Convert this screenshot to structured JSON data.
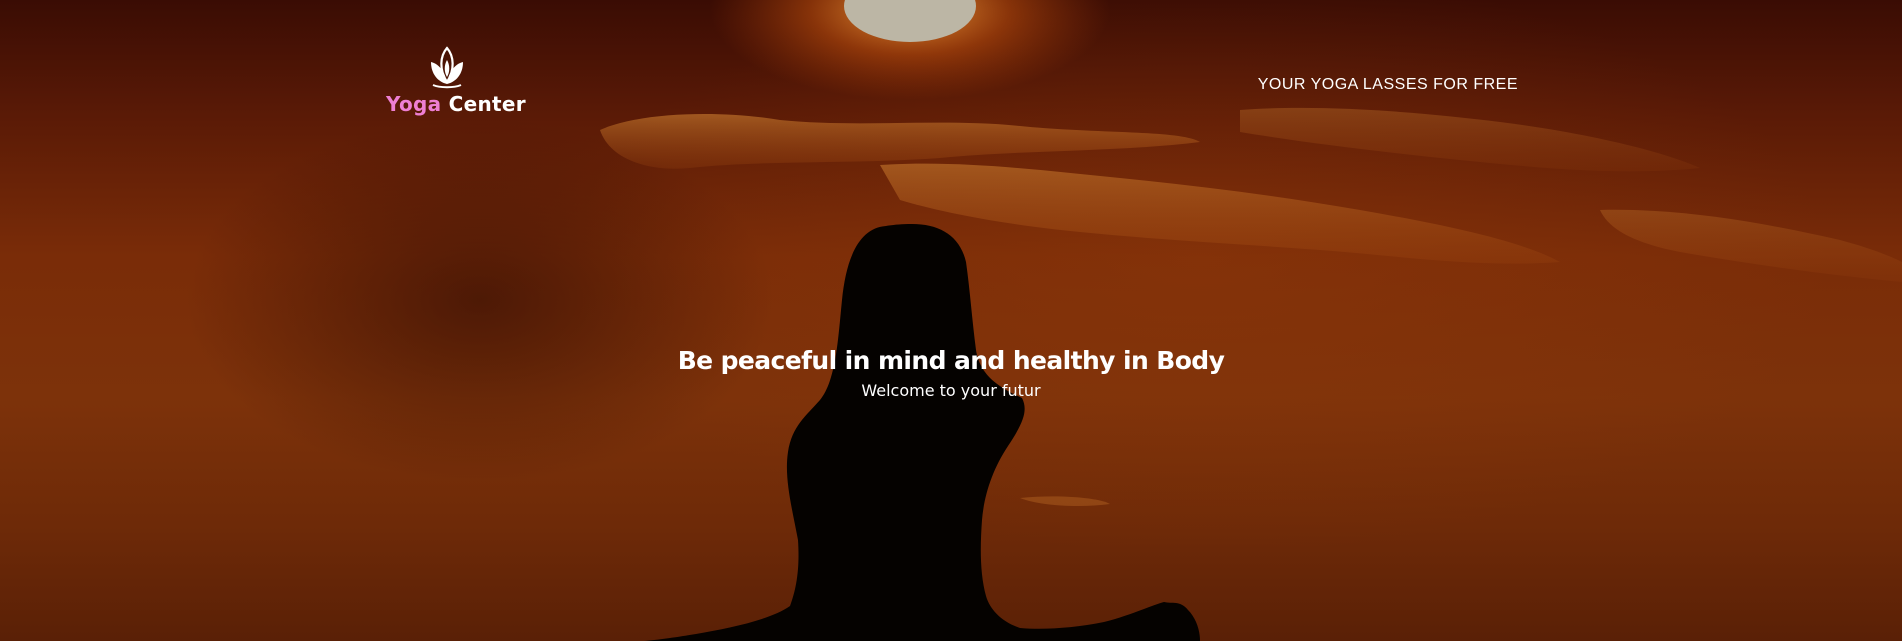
{
  "header": {
    "logo": {
      "icon": "lotus-icon",
      "word_1": "Yoga",
      "word_2": "Center"
    },
    "nav_link": "YOUR YOGA LASSES FOR FREE"
  },
  "hero": {
    "title": "Be peaceful in mind and healthy in Body",
    "subtitle": "Welcome to your futur",
    "background": "sunset-yoga-silhouette"
  },
  "colors": {
    "logo_accent": "#ee7fd3",
    "text": "#ffffff",
    "sky_dark": "#3a0c04",
    "sky_mid": "#7d320a",
    "sun": "#b9b4a6"
  }
}
